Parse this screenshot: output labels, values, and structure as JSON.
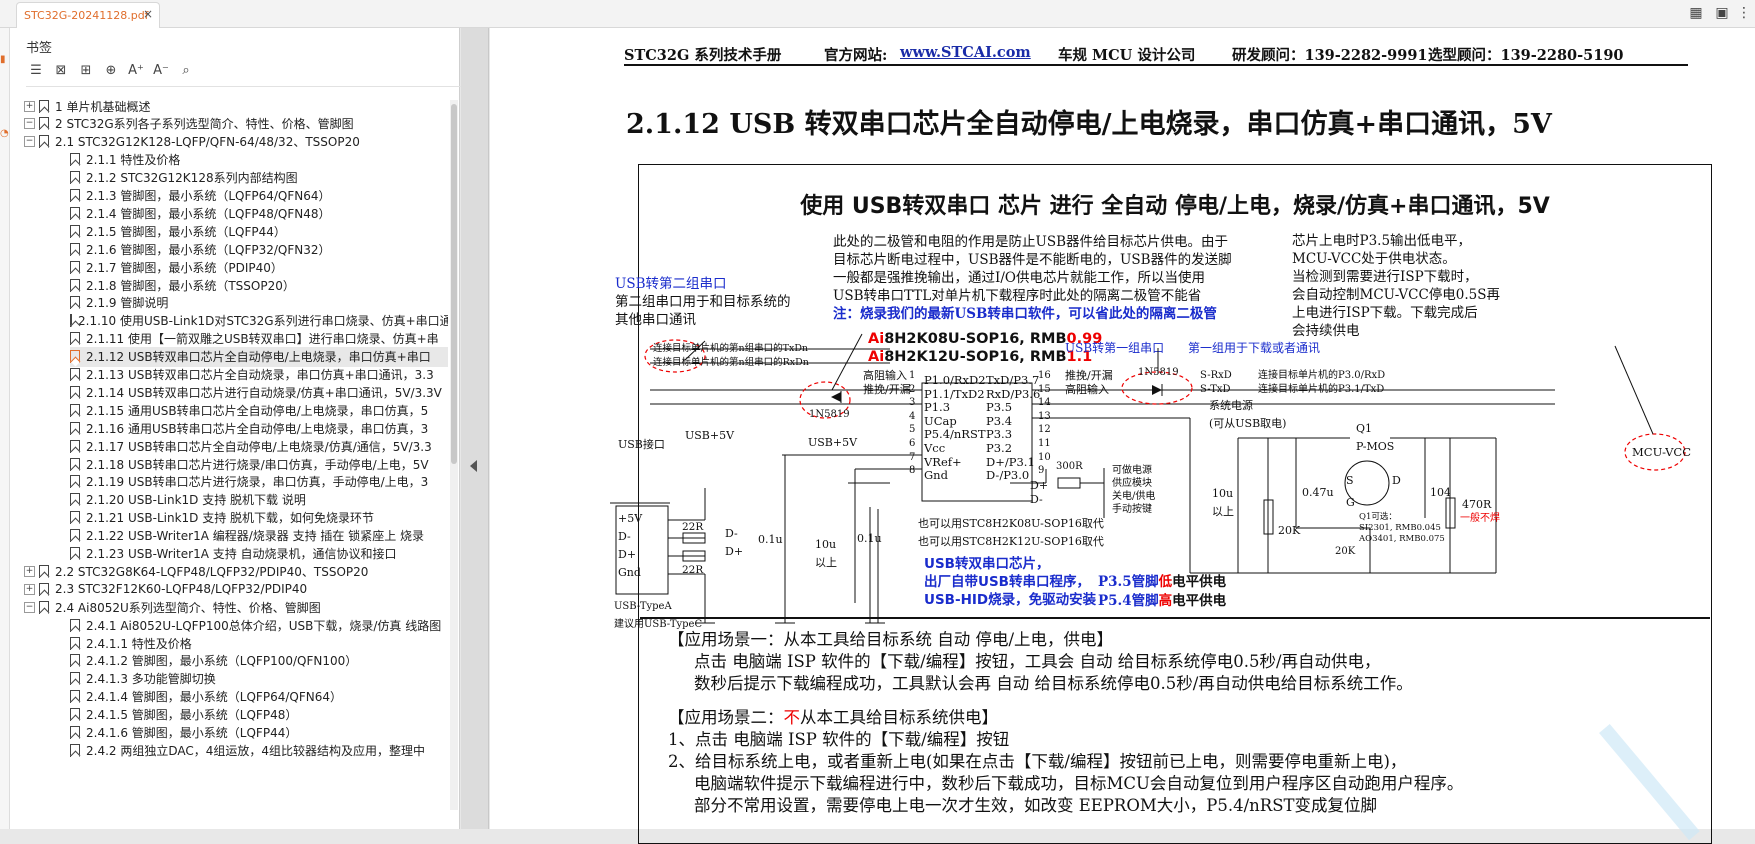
{
  "tab": {
    "title": "STC32G-20241128.pdf",
    "close": "×"
  },
  "sidebar": {
    "title": "书签",
    "tools": [
      "list-icon",
      "bookmark-delete-icon",
      "bookmark-add-icon",
      "bookmark-add-child-icon",
      "font-increase-icon",
      "font-decrease-icon",
      "bookmark-search-icon"
    ],
    "tree": [
      {
        "label": "1 单片机基础概述",
        "level": 0,
        "exp": "+"
      },
      {
        "label": "2 STC32G系列各子系列选型简介、特性、价格、管脚图",
        "level": 0,
        "exp": "−"
      },
      {
        "label": "2.1 STC32G12K128-LQFP/QFN-64/48/32、TSSOP20",
        "level": 1,
        "exp": "−"
      },
      {
        "label": "2.1.1 特性及价格",
        "level": 2
      },
      {
        "label": "2.1.2 STC32G12K128系列内部结构图",
        "level": 2
      },
      {
        "label": "2.1.3 管脚图，最小系统（LQFP64/QFN64）",
        "level": 2
      },
      {
        "label": "2.1.4 管脚图，最小系统（LQFP48/QFN48）",
        "level": 2
      },
      {
        "label": "2.1.5 管脚图，最小系统（LQFP44）",
        "level": 2
      },
      {
        "label": "2.1.6 管脚图，最小系统（LQFP32/QFN32）",
        "level": 2
      },
      {
        "label": "2.1.7 管脚图，最小系统（PDIP40）",
        "level": 2
      },
      {
        "label": "2.1.8 管脚图，最小系统（TSSOP20）",
        "level": 2
      },
      {
        "label": "2.1.9 管脚说明",
        "level": 2
      },
      {
        "label": "2.1.10 使用USB-Link1D对STC32G系列进行串口烧录、仿真+串口通",
        "level": 2
      },
      {
        "label": "2.1.11 使用【一箭双雕之USB转双串口】进行串口烧录、仿真+串",
        "level": 2
      },
      {
        "label": "2.1.12 USB转双串口芯片全自动停电/上电烧录，串口仿真+串口",
        "level": 2,
        "selected": true
      },
      {
        "label": "2.1.13 USB转双串口芯片全自动烧录，串口仿真+串口通讯，3.3",
        "level": 2
      },
      {
        "label": "2.1.14 USB转双串口芯片进行自动烧录/仿真+串口通讯，5V/3.3V",
        "level": 2
      },
      {
        "label": "2.1.15 通用USB转串口芯片全自动停电/上电烧录，串口仿真，5",
        "level": 2
      },
      {
        "label": "2.1.16 通用USB转串口芯片全自动停电/上电烧录，串口仿真，3",
        "level": 2
      },
      {
        "label": "2.1.17 USB转串口芯片全自动停电/上电烧录/仿真/通信，5V/3.3",
        "level": 2
      },
      {
        "label": "2.1.18 USB转串口芯片进行烧录/串口仿真，手动停电/上电，5V",
        "level": 2
      },
      {
        "label": "2.1.19 USB转串口芯片进行烧录，串口仿真，手动停电/上电，3",
        "level": 2
      },
      {
        "label": "2.1.20 USB-Link1D 支持 脱机下载 说明",
        "level": 2
      },
      {
        "label": "2.1.21 USB-Link1D 支持 脱机下载，如何免烧录环节",
        "level": 2
      },
      {
        "label": "2.1.22 USB-Writer1A 编程器/烧录器 支持 插在 锁紧座上 烧录",
        "level": 2
      },
      {
        "label": "2.1.23 USB-Writer1A 支持 自动烧录机，通信协议和接口",
        "level": 2
      },
      {
        "label": "2.2 STC32G8K64-LQFP48/LQFP32/PDIP40、TSSOP20",
        "level": 1,
        "exp": "+"
      },
      {
        "label": "2.3 STC32F12K60-LQFP48/LQFP32/PDIP40",
        "level": 1,
        "exp": "+"
      },
      {
        "label": "2.4 Ai8052U系列选型简介、特性、价格、管脚图",
        "level": 1,
        "exp": "−"
      },
      {
        "label": "2.4.1 Ai8052U-LQFP100总体介绍，USB下载，烧录/仿真 线路图",
        "level": 2
      },
      {
        "label": "2.4.1.1 特性及价格",
        "level": 2
      },
      {
        "label": "2.4.1.2 管脚图，最小系统（LQFP100/QFN100）",
        "level": 2
      },
      {
        "label": "2.4.1.3 多功能管脚切换",
        "level": 2
      },
      {
        "label": "2.4.1.4 管脚图，最小系统（LQFP64/QFN64）",
        "level": 2
      },
      {
        "label": "2.4.1.5 管脚图，最小系统（LQFP48）",
        "level": 2
      },
      {
        "label": "2.4.1.6 管脚图，最小系统（LQFP44）",
        "level": 2
      },
      {
        "label": "2.4.2 两组独立DAC，4组运放，4组比较器结构及应用，整理中",
        "level": 2
      }
    ]
  },
  "page": {
    "header": {
      "manual": "STC32G 系列技术手册",
      "site_label": "官方网站:",
      "site": "www.STCAI.com",
      "company": "车规 MCU 设计公司",
      "dev": "研发顾问：139-2282-9991",
      "sel": "选型顾问：139-2280-5190"
    },
    "section_title": "2.1.12    USB 转双串口芯片全自动停电/上电烧录，串口仿真+串口通讯，5V",
    "diagram": {
      "title": "使用 USB转双串口 芯片 进行 全自动 停电/上电，烧录/仿真+串口通讯，5V",
      "note1": [
        "此处的二极管和电阻的作用是防止USB器件给目标芯片供电。由于",
        "目标芯片断电过程中，USB器件是不能断电的，USB器件的发送脚",
        "一般都是强推挽输出，通过I/O供电芯片就能工作，所以当使用",
        "USB转串口TTL对单片机下载程序时此处的隔离二极管不能省"
      ],
      "note1_blue": "注：烧录我们的最新USB转串口软件，可以省此处的隔离二极管",
      "note2": [
        "芯片上电时P3.5输出低电平，",
        "MCU-VCC处于供电状态。",
        "当检测到需要进行ISP下载时，",
        "会自动控制MCU-VCC停电0.5S再",
        "上电进行ISP下载。下载完成后",
        "会持续供电"
      ],
      "usb2_title": "USB转第二组串口",
      "usb2_desc": [
        "第二组串口用于和目标系统的",
        "其他串口通讯"
      ],
      "chip1": {
        "pre": "Ai",
        "name": "8H2K08U-SOP16, RMB",
        "price": "0.99"
      },
      "chip2": {
        "pre": "Ai",
        "name": "8H2K12U-SOP16, RMB",
        "price": "1.1"
      },
      "usb1": "USB转第一组串口",
      "grp1": "第一组用于下载或者通讯",
      "left_pins": [
        "P1.0/RxD2",
        "P1.1/TxD2",
        "P1.3",
        "UCap",
        "P5.4/nRST",
        "Vcc",
        "VRef+",
        "Gnd"
      ],
      "left_nums": [
        "1",
        "2",
        "3",
        "4",
        "5",
        "6",
        "7",
        "8"
      ],
      "right_pins": [
        "TxD/P3.7",
        "RxD/P3.6",
        "P3.5",
        "P3.4",
        "P3.3",
        "P3.2",
        "D+/P3.1",
        "D-/P3.0"
      ],
      "right_nums": [
        "16",
        "15",
        "14",
        "13",
        "12",
        "11",
        "10",
        "9"
      ],
      "lbl_hz": "高阻输入",
      "lbl_tl": "推挽/开漏",
      "lbl_tl2": "推挽/开漏",
      "lbl_hz2": "高阻输入",
      "line1": "连接目标单片机的第n组串口的TxDn",
      "line2": "连接目标单片机的第n组串口的RxDn",
      "d1": "1N5819",
      "d2": "1N5819",
      "srxd": "S-RxD",
      "stxd": "S-TxD",
      "tgt1": "连接目标单片机的P3.0/RxD",
      "tgt2": "连接目标单片机的P3.1/TxD",
      "sys_pwr": [
        "系统电源",
        "(可从USB取电)"
      ],
      "usb_port": "USB接口",
      "usb5v": "USB+5V",
      "usb5v2": "USB+5V",
      "port_pins": [
        "+5V",
        "D-",
        "D+",
        "Gnd"
      ],
      "r22a": "22R",
      "r22b": "22R",
      "dm": "D-",
      "dp": "D+",
      "dm2": "D-",
      "dp2": "D+",
      "cap01": "0.1u",
      "cap10": [
        "10u",
        "以上"
      ],
      "cap01b": "0.1u",
      "usb_type": [
        "USB-TypeA",
        "建议用USB-TypeC"
      ],
      "r300": "300R",
      "btn": [
        "可做电源",
        "供应模块",
        "关电/供电",
        "手动按键"
      ],
      "alt": [
        "也可以用STC8H2K08U-SOP16取代",
        "也可以用STC8H2K12U-SOP16取代"
      ],
      "blue_bold": [
        "USB转双串口芯片，",
        "出厂自带USB转串口程序，",
        "USB-HID烧录，免驱动安装"
      ],
      "p35": {
        "a": "P3.5管脚",
        "b": "低",
        "c": "电平供电"
      },
      "p54": {
        "a": "P5.4管脚",
        "b": "高",
        "c": "电平供电"
      },
      "cap10b": [
        "10u",
        "以上"
      ],
      "r20k": "20K",
      "c047": "0.47u",
      "r20k2": "20K",
      "q1": [
        "Q1",
        "P-MOS"
      ],
      "g": "G",
      "s": "S",
      "d": "D",
      "q1opt": [
        "Q1可选：",
        "SI2301, RMB0.045",
        "AO3401, RMB0.075"
      ],
      "c104": "104",
      "r470": "470R",
      "nosolder": "一般不焊",
      "mcu": "MCU-VCC"
    },
    "scene1": {
      "title": "【应用场景一：从本工具给目标系统 自动 停电/上电，供电】",
      "l1": "点击 电脑端 ISP 软件的【下载/编程】按钮，工具会 自动 给目标系统停电0.5秒/再自动供电，",
      "l2": "数秒后提示下载编程成功，工具默认会再 自动 给目标系统停电0.5秒/再自动供电给目标系统工作。"
    },
    "scene2": {
      "a": "【应用场景二：",
      "b": "不",
      "c": "从本工具给目标系统供电】",
      "l1": "1、点击 电脑端 ISP 软件的【下载/编程】按钮",
      "l2": "2、给目标系统上电，或者重新上电(如果在点击【下载/编程】按钮前已上电，则需要停电重新上电)，",
      "l3": "电脑端软件提示下载编程进行中，数秒后下载成功，目标MCU会自动复位到用户程序区自动跑用户程序。",
      "l4": "部分不常用设置，需要停电上电一次才生效，如改变 EEPROM大小，P5.4/nRST变成复位脚"
    }
  }
}
